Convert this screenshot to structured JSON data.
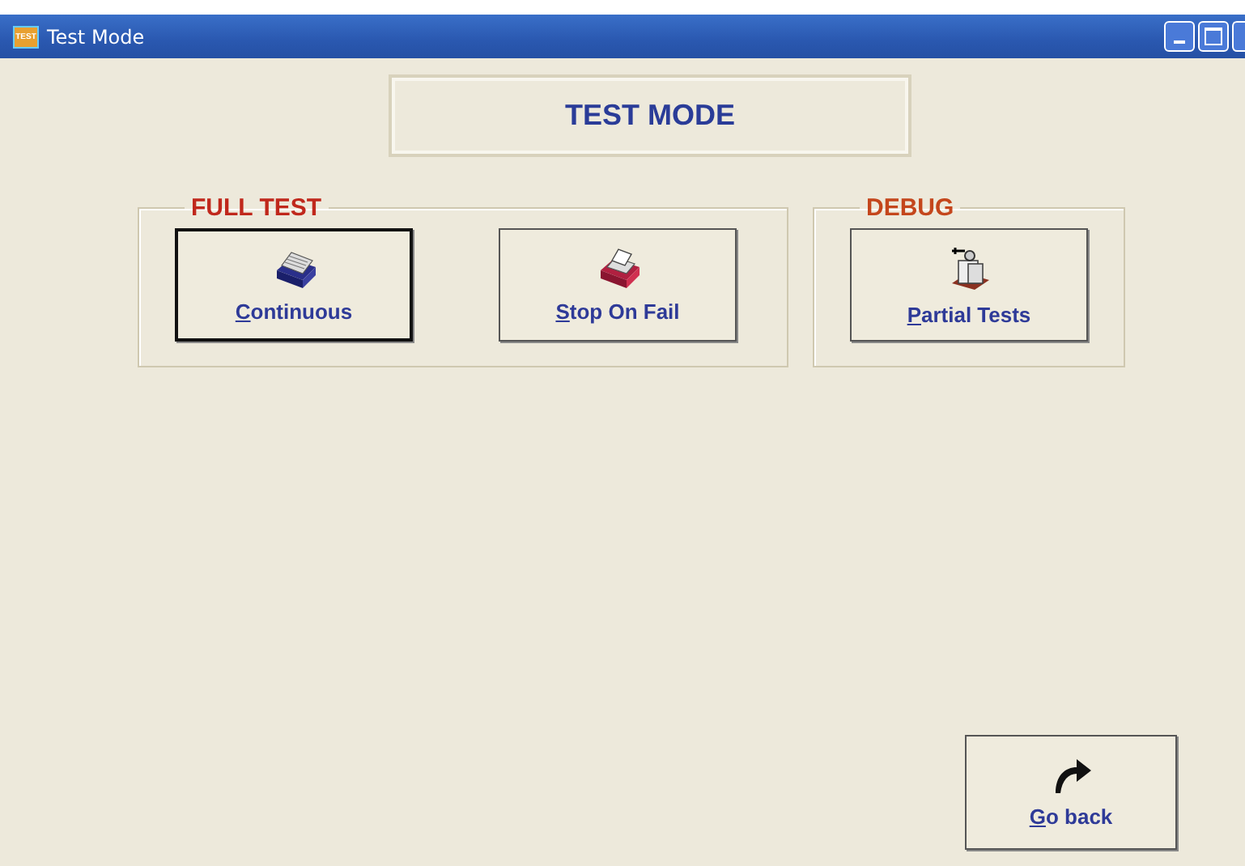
{
  "window": {
    "title": "Test Mode",
    "app_icon": "TEST"
  },
  "heading": "TEST MODE",
  "groups": [
    {
      "title": "FULL TEST",
      "color": "#c0281c",
      "buttons": [
        {
          "label": "Continuous",
          "kind": "stack",
          "focused": true
        },
        {
          "label": "Stop On Fail",
          "kind": "file",
          "focused": false
        }
      ]
    },
    {
      "title": "DEBUG",
      "color": "#c4461c",
      "buttons": [
        {
          "label": "Partial Tests",
          "kind": "partial",
          "focused": false
        }
      ]
    }
  ],
  "back_button": {
    "label": "Go back",
    "focused": false
  }
}
